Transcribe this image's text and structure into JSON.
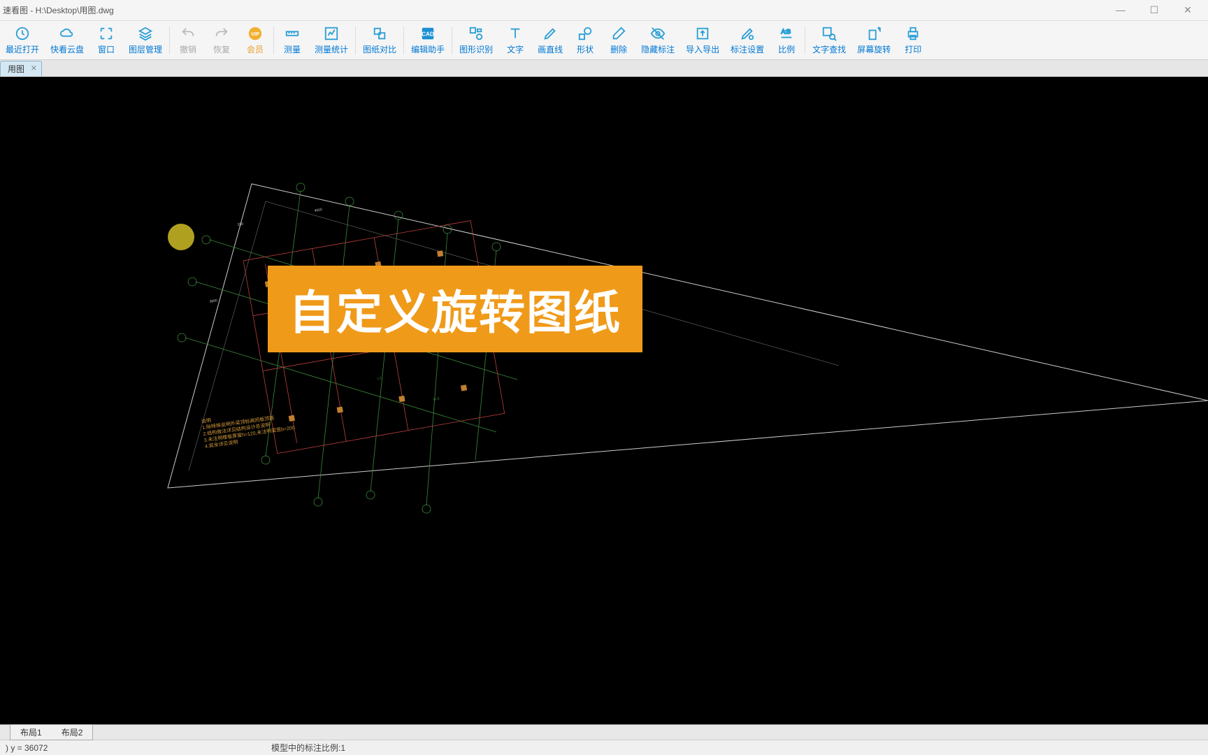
{
  "window": {
    "title": "速看图 - H:\\Desktop\\用图.dwg"
  },
  "toolbar": {
    "recent_open": "最近打开",
    "cloud": "快看云盘",
    "window": "窗口",
    "layers": "图层管理",
    "undo": "撤销",
    "redo": "恢复",
    "vip": "会员",
    "measure": "测量",
    "measure_stats": "测量统计",
    "compare": "图纸对比",
    "edit_helper": "编辑助手",
    "shape_recog": "图形识别",
    "text": "文字",
    "draw_line": "画直线",
    "shapes": "形状",
    "delete": "删除",
    "hide_annot": "隐藏标注",
    "import_export": "导入导出",
    "annot_settings": "标注设置",
    "scale": "比例",
    "text_find": "文字查找",
    "screen_rotate": "屏幕旋转",
    "print": "打印"
  },
  "tabs": {
    "file1": "用图"
  },
  "overlay": {
    "banner_text": "自定义旋转图纸"
  },
  "sheets": {
    "layout1": "布局1",
    "layout2": "布局2"
  },
  "status": {
    "coords": ") y = 36072",
    "scale_text": "模型中的标注比例:1"
  },
  "drawing_notes": {
    "line1": "说明",
    "line2": "1.除特殊说明外梁顶标高同板顶面",
    "line3": "2.结构做法详见结构设计总说明",
    "line4": "3.未注明楼板厚度h=120,未注明梁宽b=200",
    "line5": "4.其余详见说明"
  }
}
